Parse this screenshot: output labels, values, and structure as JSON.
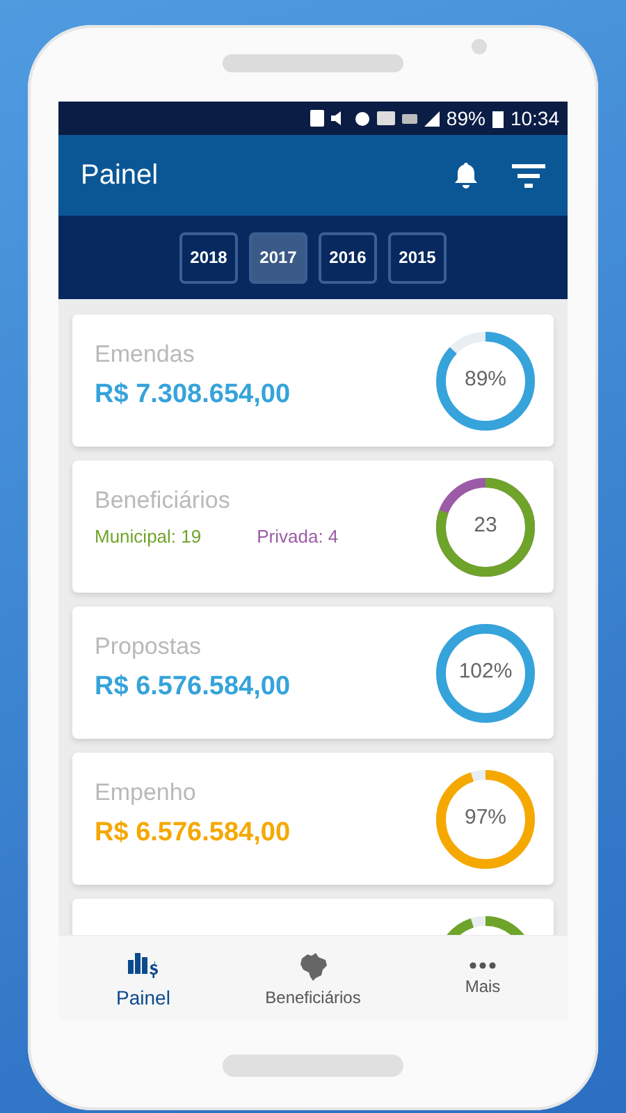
{
  "status_bar": {
    "battery_percent": "89%",
    "time": "10:34"
  },
  "app_bar": {
    "title": "Painel"
  },
  "years": [
    {
      "label": "2018",
      "selected": false
    },
    {
      "label": "2017",
      "selected": true
    },
    {
      "label": "2016",
      "selected": false
    },
    {
      "label": "2015",
      "selected": false
    }
  ],
  "cards": [
    {
      "kind": "amount",
      "title": "Emendas",
      "value": "R$ 7.308.654,00",
      "color": "#36a3db",
      "level": 0.89,
      "center": "89%"
    },
    {
      "kind": "split",
      "title": "Beneficiários",
      "parts": [
        {
          "label": "Municipal: 19",
          "color": "#6ea42a"
        },
        {
          "label": "Privada: 4",
          "color": "#9c5ba6"
        }
      ],
      "level": 0.826,
      "center": "23"
    },
    {
      "kind": "amount",
      "title": "Propostas",
      "value": "R$ 6.576.584,00",
      "color": "#36a3db",
      "level": 1,
      "center": "102%"
    },
    {
      "kind": "amount",
      "title": "Empenho",
      "value": "R$ 6.576.584,00",
      "color": "#f5a800",
      "level": 0.97,
      "center": "97%"
    },
    {
      "kind": "amount",
      "color": "#6ea42a"
    }
  ],
  "nav": [
    {
      "label": "Painel",
      "kind": "chart",
      "selected": true
    },
    {
      "label": "Beneficiários",
      "kind": "map",
      "selected": false
    },
    {
      "label": "Mais",
      "kind": "more",
      "selected": false
    }
  ]
}
